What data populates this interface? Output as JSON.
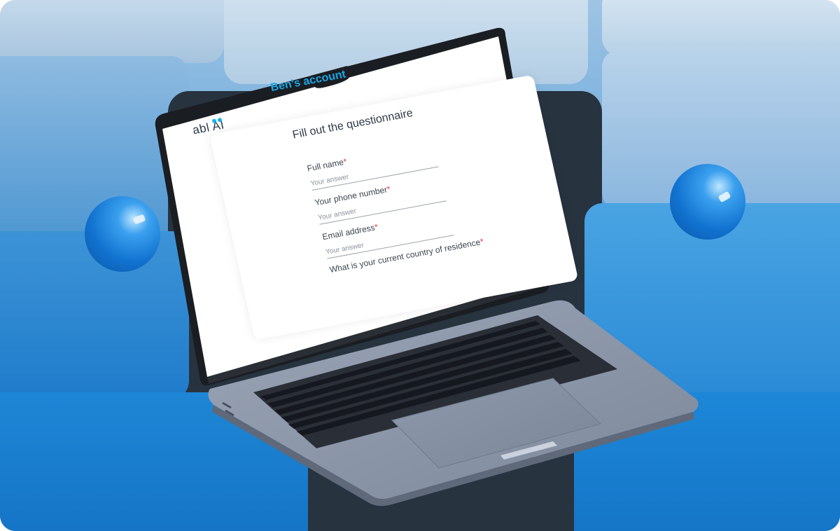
{
  "app": {
    "brand": "abl AI",
    "account_title": "Ben's account",
    "page_title": "Fill out the questionnaire"
  },
  "form": {
    "fields": [
      {
        "label": "Full name",
        "required_mark": "*",
        "placeholder": "Your answer"
      },
      {
        "label": "Your phone number",
        "required_mark": "*",
        "placeholder": "Your answer"
      },
      {
        "label": "Email address",
        "required_mark": "*",
        "placeholder": "Your answer"
      },
      {
        "label": "What is your current country of residence",
        "required_mark": "*"
      }
    ]
  },
  "colors": {
    "accent": "#1aa8e6",
    "required": "#e23b3b",
    "laptop": "#8f9aad"
  }
}
